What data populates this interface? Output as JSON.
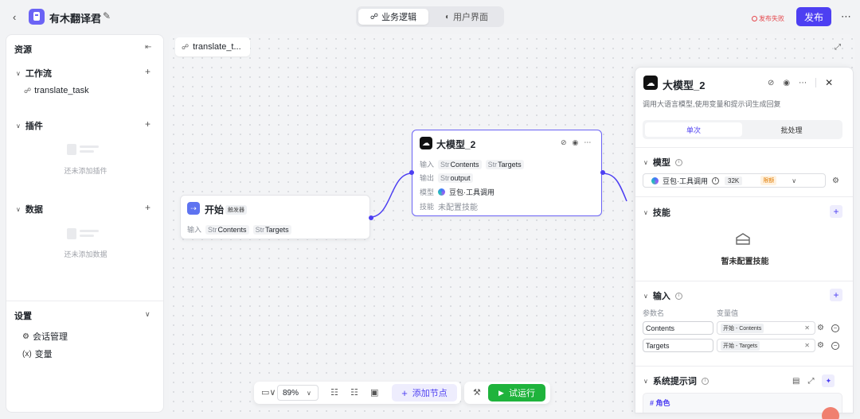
{
  "topbar": {
    "app_name": "有木翻译君",
    "tabs": [
      {
        "label": "业务逻辑",
        "active": true
      },
      {
        "label": "用户界面",
        "active": false
      }
    ],
    "publish_status": "发布失败",
    "publish_label": "发布"
  },
  "sidebar": {
    "title": "资源",
    "workflow": {
      "label": "工作流",
      "items": [
        "translate_task"
      ]
    },
    "plugins": {
      "label": "插件",
      "empty": "还未添加插件"
    },
    "data": {
      "label": "数据",
      "empty": "还未添加数据"
    },
    "settings": {
      "label": "设置",
      "items": [
        "会话管理",
        "变量"
      ]
    }
  },
  "canvas": {
    "tab_label": "translate_t...",
    "start_node": {
      "title": "开始",
      "badge": "触发器",
      "input_label": "输入",
      "inputs": [
        {
          "type": "Str",
          "name": "Contents"
        },
        {
          "type": "Str",
          "name": "Targets"
        }
      ]
    },
    "llm_node": {
      "title": "大模型_2",
      "input_label": "输入",
      "inputs": [
        {
          "type": "Str",
          "name": "Contents"
        },
        {
          "type": "Str",
          "name": "Targets"
        }
      ],
      "output_label": "输出",
      "output": {
        "type": "Str",
        "name": "output"
      },
      "model_label": "模型",
      "model": "豆包·工具调用",
      "skill_label": "技能",
      "skill_value": "未配置技能"
    },
    "toolbar": {
      "zoom": "89%",
      "add_node_label": "添加节点",
      "run_label": "试运行"
    }
  },
  "config_panel": {
    "title": "大模型_2",
    "description": "调用大语言模型,使用变量和提示词生成回复",
    "modes": [
      {
        "label": "单次",
        "active": true
      },
      {
        "label": "批处理",
        "active": false
      }
    ],
    "model_section": "模型",
    "model_name": "豆包·工具调用",
    "model_context": "32K",
    "model_tag": "限额",
    "skill_section": "技能",
    "skill_empty": "暂未配置技能",
    "input_section": "输入",
    "col_param": "参数名",
    "col_value": "变量值",
    "input_rows": [
      {
        "name": "Contents",
        "ref": "开始 - Contents"
      },
      {
        "name": "Targets",
        "ref": "开始 - Targets"
      }
    ],
    "system_section": "系统提示词",
    "system_heading": "# 角色"
  },
  "colors": {
    "accent": "#4d3ff2",
    "run_green": "#1fb33c",
    "error_red": "#e5484d"
  }
}
